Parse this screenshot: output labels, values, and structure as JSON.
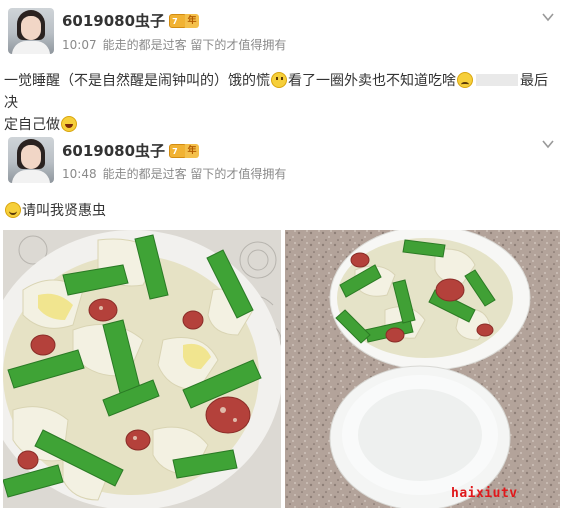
{
  "posts": [
    {
      "username": "6019080虫子",
      "badge_level": "7",
      "badge_year": "年",
      "time": "10:07",
      "signature": "能走的都是过客 留下的才值得拥有",
      "text_part1": "一觉睡醒（不是自然醒是闹钟叫的）饿的慌",
      "text_part2": "看了一圈外卖也不知道吃啥",
      "text_part3": "最后决",
      "text_line2": "定自己做",
      "emojis": [
        "sad-face-icon",
        "thinking-face-icon",
        "laughing-face-icon"
      ]
    },
    {
      "username": "6019080虫子",
      "badge_level": "7",
      "badge_year": "年",
      "time": "10:48",
      "signature": "能走的都是过客 留下的才值得拥有",
      "text": "请叫我贤惠虫",
      "emojis": [
        "smile-face-icon"
      ]
    }
  ],
  "photos": [
    {
      "subject": "stir-fried green pepper, napa cabbage and sausage on a patterned plate"
    },
    {
      "subject": "bowl of stir-fried vegetables with sausage and a bowl of rice on granite counter"
    }
  ],
  "watermark": "haixiutv",
  "colors": {
    "username": "#333333",
    "meta": "#8a8a8a",
    "badge": "#f1b233",
    "watermark": "#e0181b"
  }
}
